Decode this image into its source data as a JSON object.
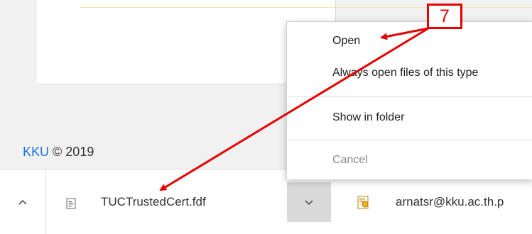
{
  "footer": {
    "brand": "KKU",
    "copyright": "© 2019"
  },
  "context_menu": {
    "items": [
      {
        "label": "Open",
        "enabled": true
      },
      {
        "label": "Always open files of this type",
        "enabled": true
      },
      {
        "label": "Show in folder",
        "enabled": true
      },
      {
        "label": "Cancel",
        "enabled": false
      }
    ]
  },
  "download_shelf": {
    "items": [
      {
        "filename": "TUCTrustedCert.fdf",
        "icon": "fdf-file-icon"
      },
      {
        "filename": "arnatsr@kku.ac.th.p",
        "icon": "certificate-file-icon"
      }
    ]
  },
  "annotation": {
    "step": "7",
    "color": "#e60000"
  },
  "colors": {
    "link": "#1a73e8",
    "annotation": "#e60000"
  }
}
